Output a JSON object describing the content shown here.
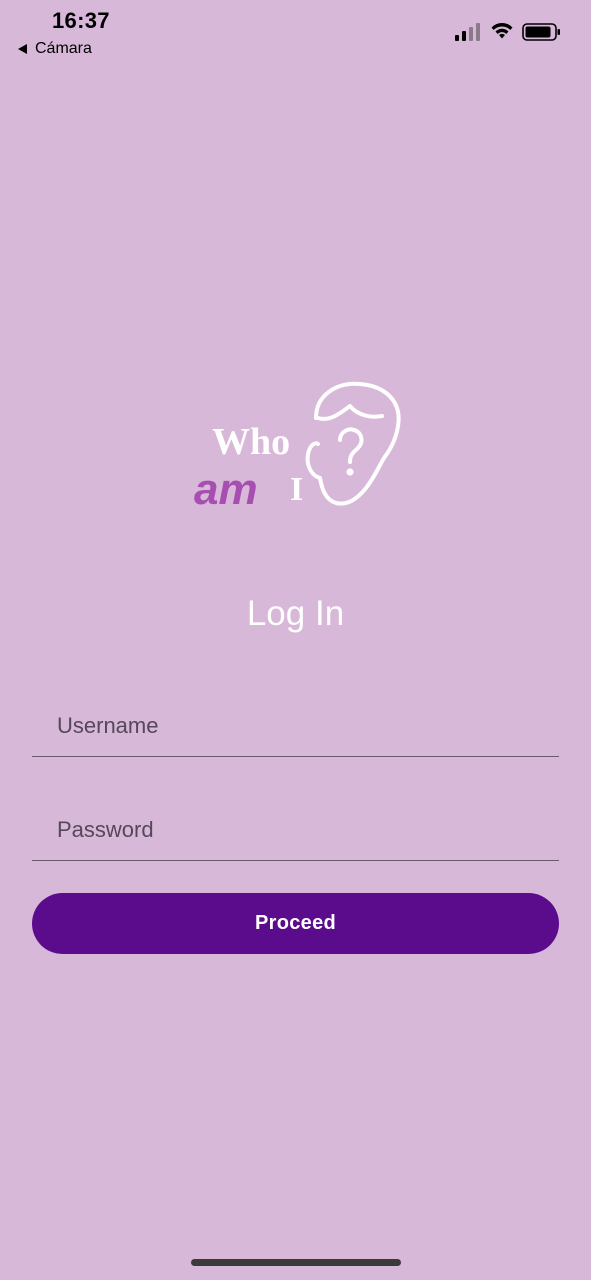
{
  "status_bar": {
    "time": "16:37",
    "back_label": "Cámara",
    "icons": [
      "cellular-signal-icon",
      "wifi-icon",
      "battery-icon"
    ]
  },
  "logo": {
    "line1": "Who",
    "line2_word": "am",
    "line2_letter": "I",
    "icon": "face-question-icon",
    "accent_color": "#a64fb0"
  },
  "login": {
    "title": "Log In",
    "username_placeholder": "Username",
    "password_placeholder": "Password",
    "proceed_label": "Proceed"
  },
  "colors": {
    "background": "#d8b8d8",
    "button": "#5a0c8c",
    "title": "#ffffff"
  }
}
